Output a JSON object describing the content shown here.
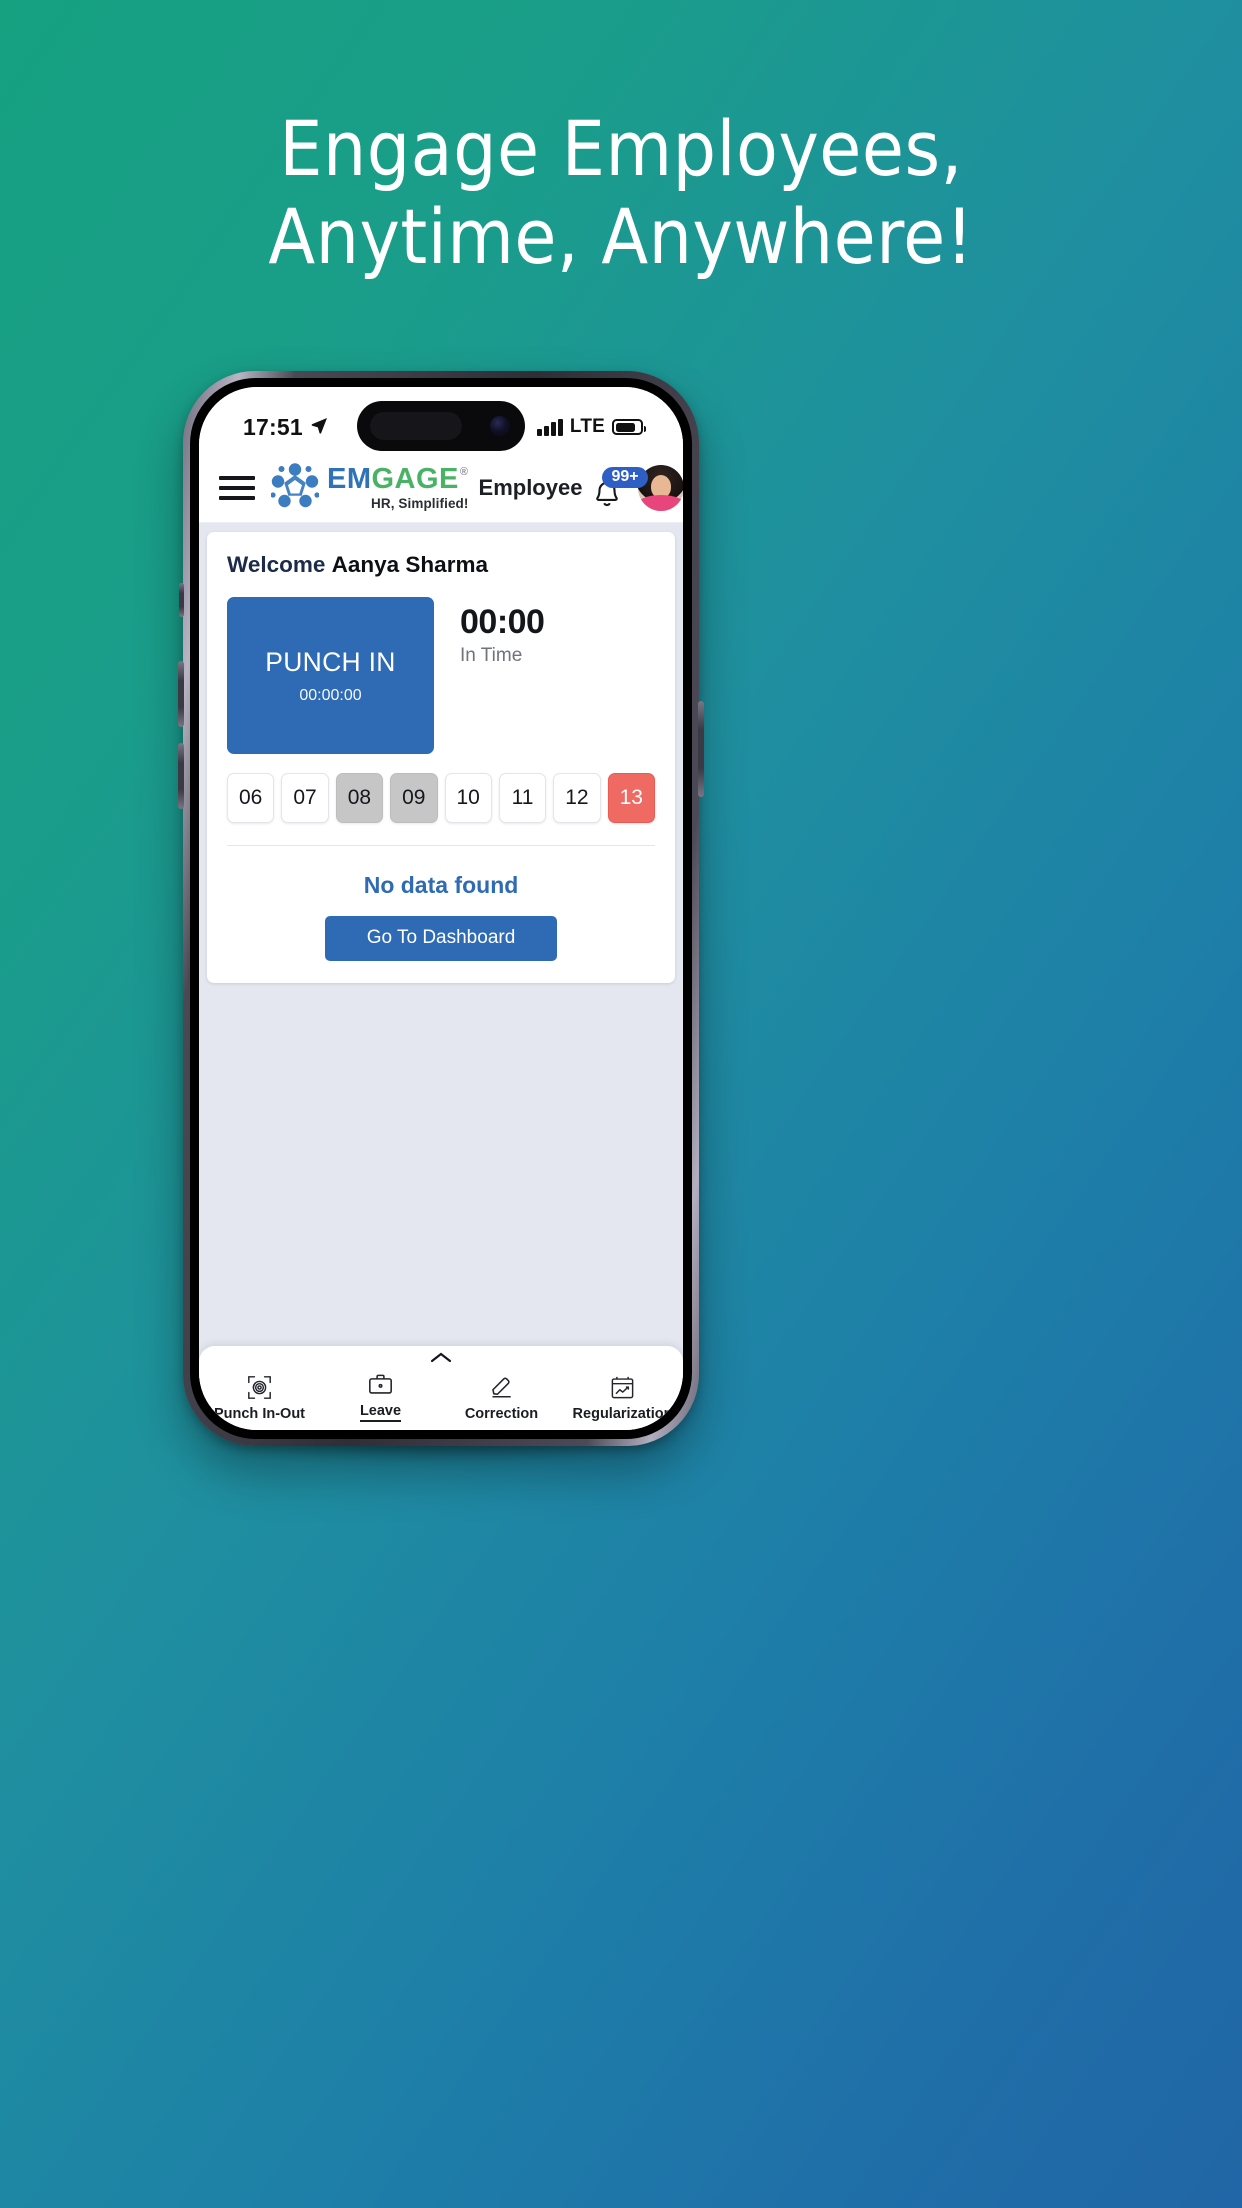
{
  "promo": {
    "headline_line1": "Engage Employees,",
    "headline_line2": "Anytime, Anywhere!",
    "background_gradient_from": "#16a181",
    "background_gradient_to": "#2166a6",
    "headline_color": "#ffffff"
  },
  "status_bar": {
    "time": "17:51",
    "location_icon": "location-arrow-icon",
    "network_label": "LTE",
    "signal_icon": "signal-bars-icon",
    "battery_icon": "battery-icon"
  },
  "app_header": {
    "menu_icon": "hamburger-menu-icon",
    "logo_icon": "emgage-people-logo-icon",
    "brand_part1": "EM",
    "brand_part2": "GAGE",
    "brand_registered": "®",
    "brand_tagline": "HR, Simplified!",
    "brand_color_primary": "#2f72b8",
    "brand_color_secondary": "#49b265",
    "role_label": "Employee",
    "notification_icon": "bell-icon",
    "notification_badge": "99+",
    "notification_badge_color": "#2f5fc4",
    "avatar_icon": "user-avatar"
  },
  "dashboard_card": {
    "welcome_label": "Welcome",
    "employee_name": "Aanya Sharma",
    "punch_button_label": "PUNCH IN",
    "punch_button_timer": "00:00:00",
    "punch_button_color": "#2f6ab5",
    "in_time_value": "00:00",
    "in_time_label": "In Time",
    "date_chips": [
      {
        "day": "06",
        "state": "default"
      },
      {
        "day": "07",
        "state": "default"
      },
      {
        "day": "08",
        "state": "inactive"
      },
      {
        "day": "09",
        "state": "inactive"
      },
      {
        "day": "10",
        "state": "default"
      },
      {
        "day": "11",
        "state": "default"
      },
      {
        "day": "12",
        "state": "default"
      },
      {
        "day": "13",
        "state": "today"
      }
    ],
    "chip_inactive_color": "#c6c6c6",
    "chip_today_color": "#ef6a63",
    "empty_state_text": "No data found",
    "empty_state_color": "#2f6ab5",
    "dashboard_button_label": "Go To Dashboard"
  },
  "tab_bar": {
    "expand_handle_icon": "chevron-up-icon",
    "items": [
      {
        "label": "Punch In-Out",
        "icon": "fingerprint-scan-icon",
        "active": false
      },
      {
        "label": "Leave",
        "icon": "briefcase-icon",
        "active": true
      },
      {
        "label": "Correction",
        "icon": "pencil-edit-icon",
        "active": false
      },
      {
        "label": "Regularization",
        "icon": "calendar-chart-icon",
        "active": false
      }
    ]
  }
}
